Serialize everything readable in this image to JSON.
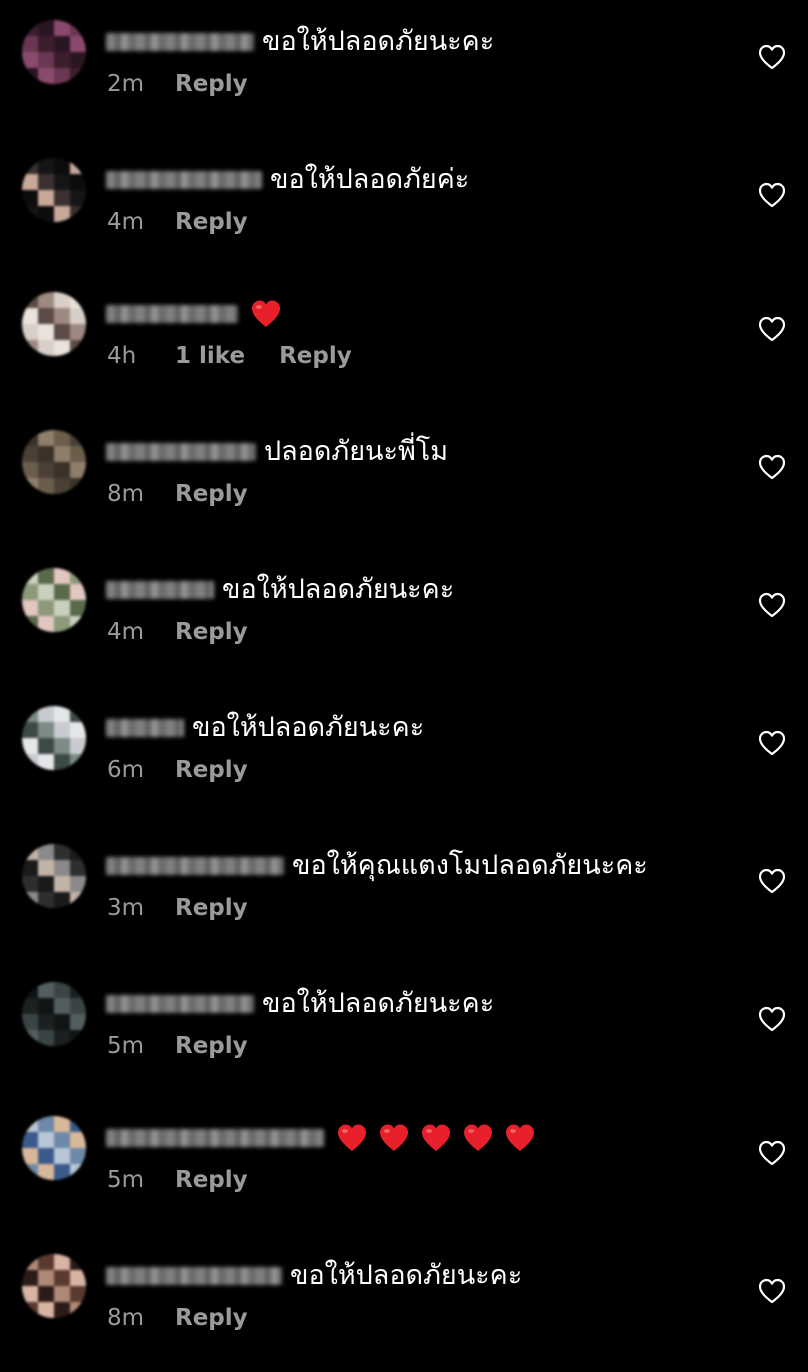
{
  "colors": {
    "background": "#000000",
    "text": "#ffffff",
    "meta_text": "#9a9a9a",
    "heart_emoji": "#e8202c",
    "like_icon": "#ffffff"
  },
  "comments": [
    {
      "text": "ขอให้ปลอดภัยนะคะ",
      "time": "2m",
      "likes": "",
      "reply": "Reply",
      "emoji_count": 0,
      "avatar_palette": [
        "#3b1e2c",
        "#6b3654",
        "#8a4a6e",
        "#2a1522"
      ]
    },
    {
      "text": "ขอให้ปลอดภัยค่ะ",
      "time": "4m",
      "likes": "",
      "reply": "Reply",
      "emoji_count": 0,
      "avatar_palette": [
        "#151515",
        "#3a3030",
        "#c9a89a",
        "#0c0c0c"
      ]
    },
    {
      "text": "",
      "time": "4h",
      "likes": "1 like",
      "reply": "Reply",
      "emoji_count": 1,
      "avatar_palette": [
        "#d8cfc8",
        "#9d8a80",
        "#5c4a44",
        "#eae2dc"
      ]
    },
    {
      "text": "ปลอดภัยนะพี่โม",
      "time": "8m",
      "likes": "",
      "reply": "Reply",
      "emoji_count": 0,
      "avatar_palette": [
        "#4a4035",
        "#6b5d4c",
        "#8f7e6a",
        "#3a3229"
      ]
    },
    {
      "text": "ขอให้ปลอดภัยนะคะ",
      "time": "4m",
      "likes": "",
      "reply": "Reply",
      "emoji_count": 0,
      "avatar_palette": [
        "#c9d0bf",
        "#8c9a7a",
        "#e2c6c0",
        "#5a6a4c"
      ]
    },
    {
      "text": "ขอให้ปลอดภัยนะคะ",
      "time": "6m",
      "likes": "",
      "reply": "Reply",
      "emoji_count": 0,
      "avatar_palette": [
        "#c8ccd0",
        "#7e8a86",
        "#3c4a44",
        "#e4e6e8"
      ]
    },
    {
      "text": "ขอให้คุณแตงโมปลอดภัยนะคะ",
      "time": "3m",
      "likes": "",
      "reply": "Reply",
      "emoji_count": 0,
      "avatar_palette": [
        "#2e2e2e",
        "#8a8a8a",
        "#c2b4a8",
        "#1a1a1a"
      ]
    },
    {
      "text": "ขอให้ปลอดภัยนะคะ",
      "time": "5m",
      "likes": "",
      "reply": "Reply",
      "emoji_count": 0,
      "avatar_palette": [
        "#1c2020",
        "#3a4444",
        "#545e5e",
        "#101414"
      ]
    },
    {
      "text": "",
      "time": "5m",
      "likes": "",
      "reply": "Reply",
      "emoji_count": 5,
      "avatar_palette": [
        "#b9c6d6",
        "#3a5a8c",
        "#d9b89a",
        "#6e88a8"
      ]
    },
    {
      "text": "ขอให้ปลอดภัยนะคะ",
      "time": "8m",
      "likes": "",
      "reply": "Reply",
      "emoji_count": 0,
      "avatar_palette": [
        "#5a3a30",
        "#b08878",
        "#2c1c18",
        "#d8b4a4"
      ]
    }
  ],
  "icons": {
    "like": "heart-outline-icon",
    "emoji": "red-heart-emoji"
  }
}
